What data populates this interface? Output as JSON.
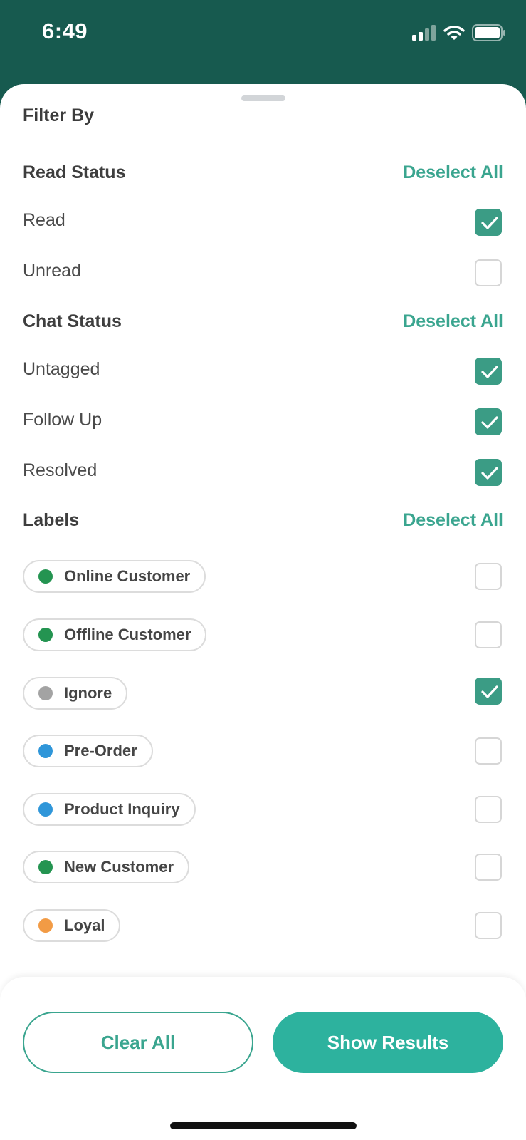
{
  "status_bar": {
    "time": "6:49"
  },
  "sheet": {
    "title": "Filter By",
    "deselect_label": "Deselect All",
    "sections": {
      "read_status": {
        "title": "Read Status",
        "options": [
          {
            "label": "Read",
            "checked": true
          },
          {
            "label": "Unread",
            "checked": false
          }
        ]
      },
      "chat_status": {
        "title": "Chat Status",
        "options": [
          {
            "label": "Untagged",
            "checked": true
          },
          {
            "label": "Follow Up",
            "checked": true
          },
          {
            "label": "Resolved",
            "checked": true
          }
        ]
      },
      "labels": {
        "title": "Labels",
        "items": [
          {
            "label": "Online Customer",
            "color": "#249451",
            "checked": false
          },
          {
            "label": "Offline Customer",
            "color": "#249451",
            "checked": false
          },
          {
            "label": "Ignore",
            "color": "#a3a3a3",
            "checked": true
          },
          {
            "label": "Pre-Order",
            "color": "#2f96d9",
            "checked": false
          },
          {
            "label": "Product Inquiry",
            "color": "#2f96d9",
            "checked": false
          },
          {
            "label": "New Customer",
            "color": "#249451",
            "checked": false
          },
          {
            "label": "Loyal",
            "color": "#f29b45",
            "checked": false
          }
        ]
      }
    }
  },
  "footer": {
    "clear_label": "Clear All",
    "show_label": "Show Results"
  },
  "colors": {
    "header": "#175a4f",
    "accent": "#3aa58f",
    "checkbox_checked": "#3b9c85",
    "primary_button": "#2db29e"
  }
}
